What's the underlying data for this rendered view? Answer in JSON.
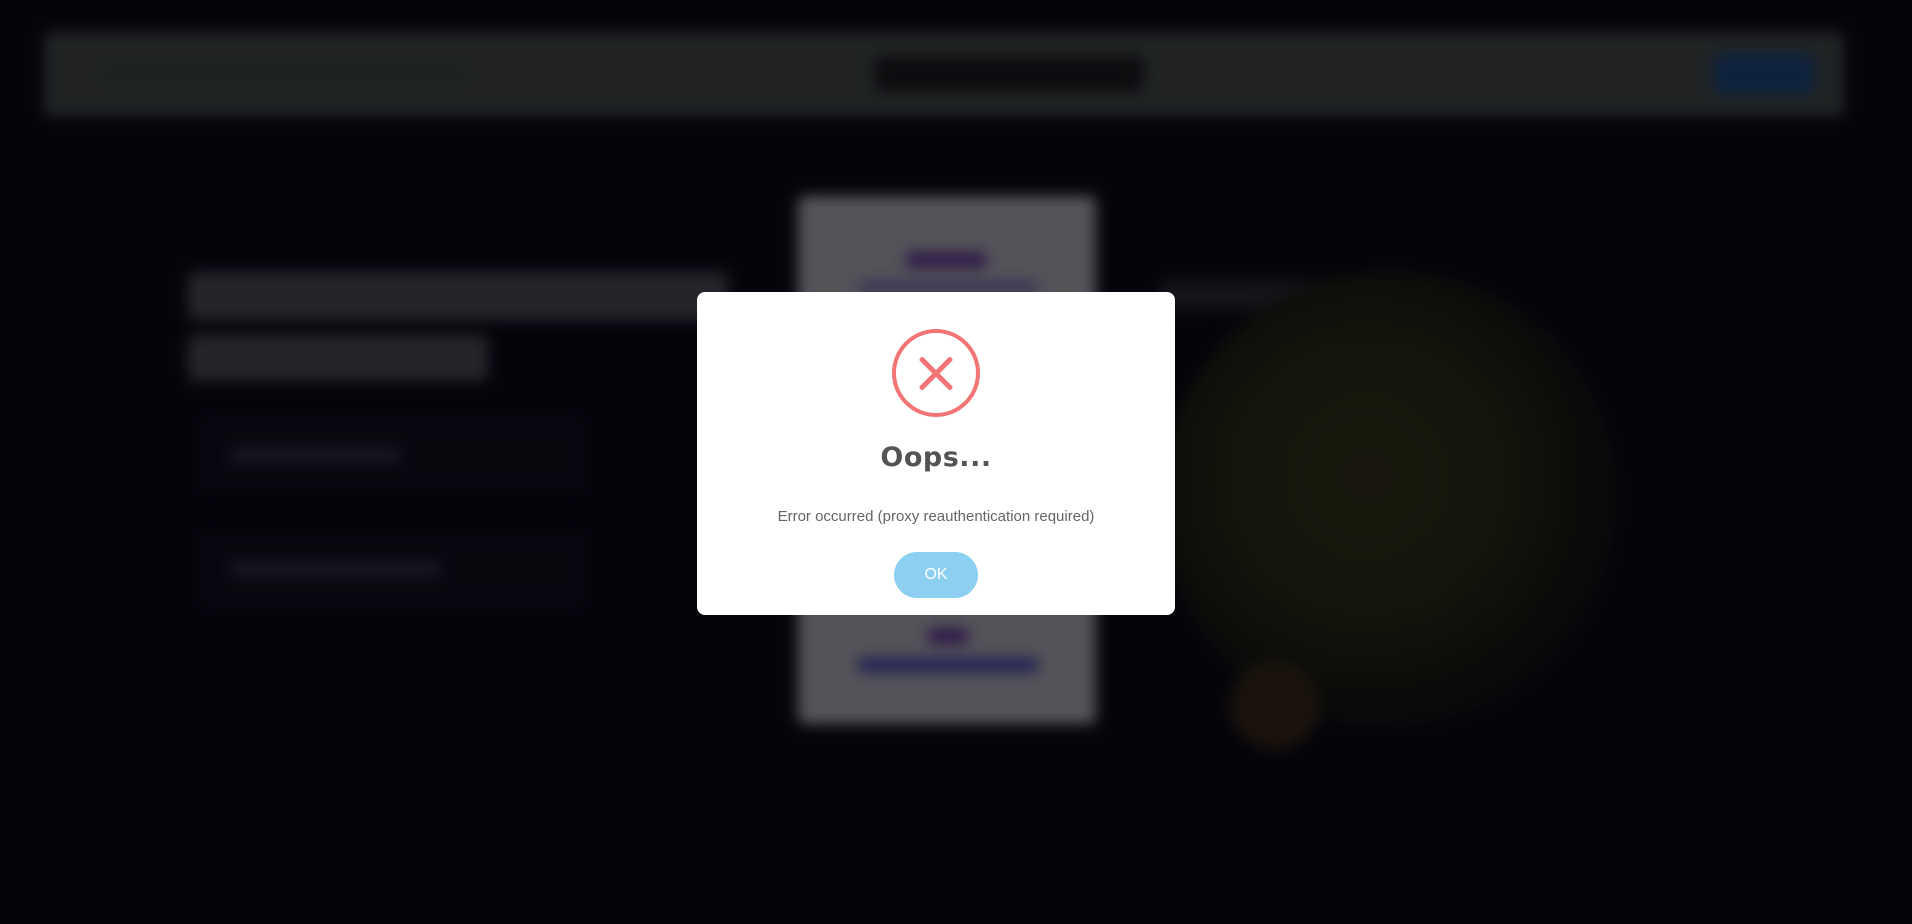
{
  "dialog": {
    "title": "Oops...",
    "message": "Error occurred (proxy reauthentication required)",
    "ok_label": "OK",
    "icon": "error-x-icon"
  },
  "colors": {
    "error_red": "#f27474",
    "ok_button": "#8ccff0",
    "backdrop": "#07060f"
  }
}
